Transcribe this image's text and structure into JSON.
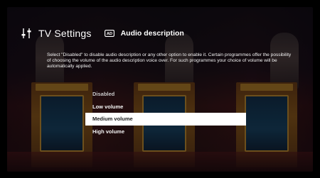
{
  "header": {
    "title": "TV Settings",
    "section_label": "Audio description"
  },
  "description": "Select \"Disabled\" to disable audio description or any other option to enable it. Certain programmes offer the possibility of choosing the volume of the audio description voice over. For such programmes your choice of volume will be automatically applied.",
  "options": [
    {
      "label": "Disabled",
      "selected": false
    },
    {
      "label": "Low volume",
      "selected": false
    },
    {
      "label": "Medium volume",
      "selected": true
    },
    {
      "label": "High volume",
      "selected": false
    }
  ],
  "colors": {
    "highlight": "#ffffff",
    "text": "#f4f4f4"
  },
  "icons": {
    "settings": "settings-sliders-icon",
    "audio_description": "audio-description-icon"
  }
}
